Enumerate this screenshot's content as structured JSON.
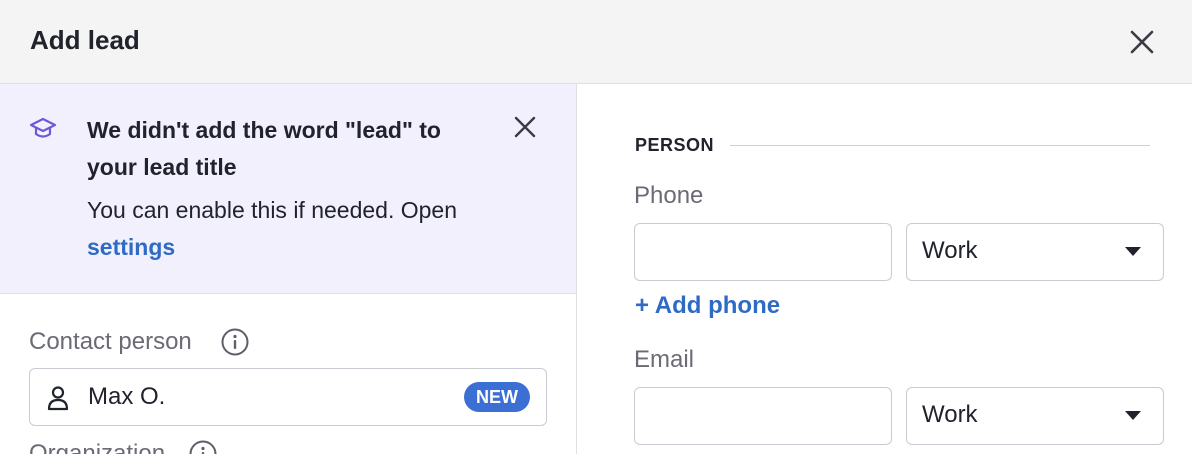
{
  "dialog": {
    "title": "Add lead",
    "close_icon": "close-icon"
  },
  "notice": {
    "icon": "graduation-cap-icon",
    "title": "We didn't add the word \"lead\" to your lead title",
    "body_prefix": "You can enable this if needed. Open ",
    "link_label": "settings",
    "accent_color": "#6b5ad6",
    "background_color": "#f1f0fc"
  },
  "left": {
    "contact_person": {
      "label": "Contact person",
      "value": "Max O.",
      "badge": "NEW",
      "icon": "person-icon"
    },
    "organization": {
      "label": "Organization"
    }
  },
  "person": {
    "section_title": "PERSON",
    "phone": {
      "label": "Phone",
      "value": "",
      "type": "Work",
      "add_label": "+ Add phone"
    },
    "email": {
      "label": "Email",
      "value": "",
      "type": "Work"
    }
  },
  "colors": {
    "link": "#2f6ac5",
    "badge": "#3b6fd4"
  }
}
